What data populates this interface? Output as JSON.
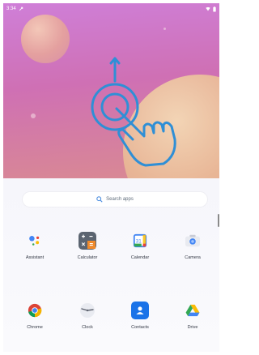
{
  "status_bar": {
    "time": "3:34"
  },
  "search": {
    "placeholder": "Search apps"
  },
  "apps": [
    {
      "label": "Assistant",
      "icon": "google-assistant-icon"
    },
    {
      "label": "Calculator",
      "icon": "calculator-icon"
    },
    {
      "label": "Calendar",
      "icon": "calendar-icon"
    },
    {
      "label": "Camera",
      "icon": "camera-icon"
    },
    {
      "label": "Chrome",
      "icon": "chrome-icon"
    },
    {
      "label": "Clock",
      "icon": "clock-icon"
    },
    {
      "label": "Contacts",
      "icon": "contacts-icon"
    },
    {
      "label": "Drive",
      "icon": "drive-icon"
    }
  ],
  "colors": {
    "gesture_stroke": "#2f8fd6",
    "calculator_bg": "#5b6470",
    "contacts_bg": "#1a73e8",
    "search_text": "#5f6c7b"
  }
}
